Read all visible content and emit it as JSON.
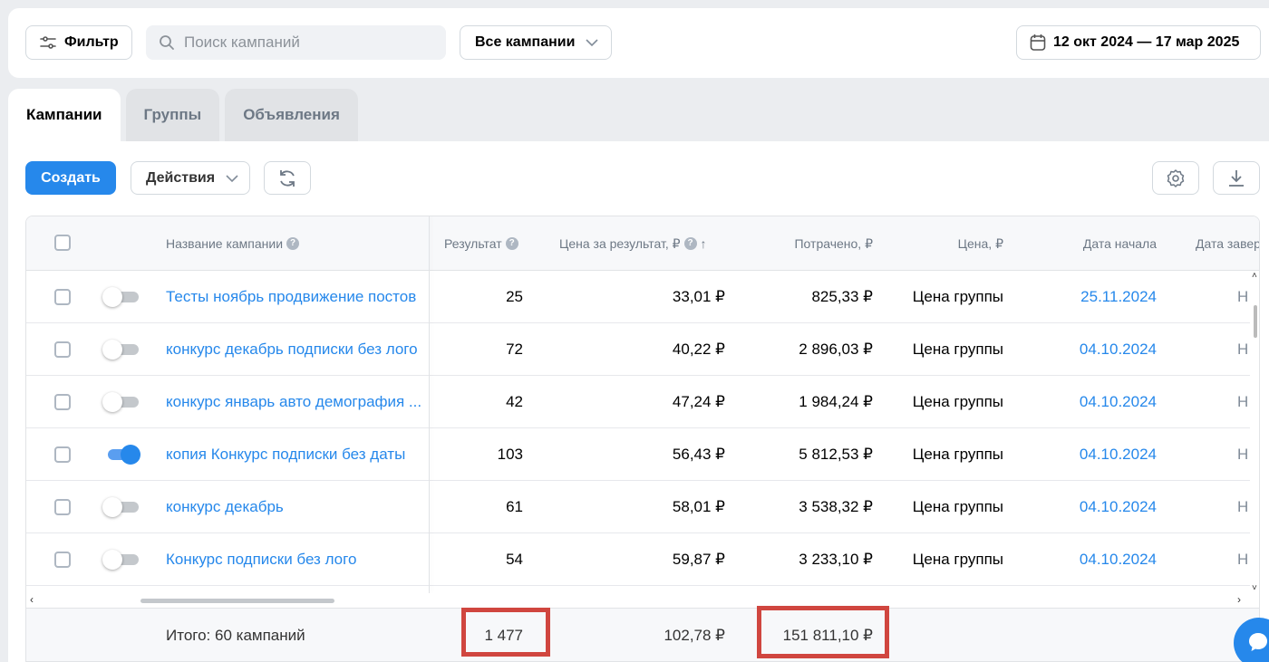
{
  "toolbar": {
    "filter_label": "Фильтр",
    "search_placeholder": "Поиск кампаний",
    "campaigns_select": "Все кампании",
    "date_range": "12 окт 2024 — 17 мар 2025"
  },
  "tabs": [
    {
      "label": "Кампании",
      "active": true
    },
    {
      "label": "Группы",
      "active": false
    },
    {
      "label": "Объявления",
      "active": false
    }
  ],
  "actions": {
    "create_label": "Создать",
    "actions_label": "Действия"
  },
  "table": {
    "columns": {
      "name": "Название кампании",
      "result": "Результат",
      "cost_per_result": "Цена за результат, ₽",
      "spent": "Потрачено, ₽",
      "price": "Цена, ₽",
      "start_date": "Дата начала",
      "end_date": "Дата завер"
    },
    "sort_indicator": "↑",
    "rows": [
      {
        "name": "Тесты ноябрь продвижение постов",
        "enabled": false,
        "result": "25",
        "cost_per_result": "33,01 ₽",
        "spent": "825,33 ₽",
        "price": "Цена группы",
        "start_date": "25.11.2024",
        "end_date": "Н"
      },
      {
        "name": "конкурс декабрь подписки без лого",
        "enabled": false,
        "result": "72",
        "cost_per_result": "40,22 ₽",
        "spent": "2 896,03 ₽",
        "price": "Цена группы",
        "start_date": "04.10.2024",
        "end_date": "Н"
      },
      {
        "name": "конкурс январь авто демография ...",
        "enabled": false,
        "result": "42",
        "cost_per_result": "47,24 ₽",
        "spent": "1 984,24 ₽",
        "price": "Цена группы",
        "start_date": "04.10.2024",
        "end_date": "Н"
      },
      {
        "name": "копия Конкурс подписки без даты",
        "enabled": true,
        "result": "103",
        "cost_per_result": "56,43 ₽",
        "spent": "5 812,53 ₽",
        "price": "Цена группы",
        "start_date": "04.10.2024",
        "end_date": "Н"
      },
      {
        "name": "конкурс декабрь",
        "enabled": false,
        "result": "61",
        "cost_per_result": "58,01 ₽",
        "spent": "3 538,32 ₽",
        "price": "Цена группы",
        "start_date": "04.10.2024",
        "end_date": "Н"
      },
      {
        "name": "Конкурс подписки без лого",
        "enabled": false,
        "result": "54",
        "cost_per_result": "59,87 ₽",
        "spent": "3 233,10 ₽",
        "price": "Цена группы",
        "start_date": "04.10.2024",
        "end_date": "Н"
      }
    ],
    "totals": {
      "label": "Итого: 60 кампаний",
      "result": "1 477",
      "cost_per_result": "102,78 ₽",
      "spent": "151 811,10 ₽"
    }
  },
  "colors": {
    "accent": "#2688eb",
    "highlight": "#d0463f",
    "background": "#ebedf0"
  },
  "icons": [
    "filter-icon",
    "search-icon",
    "chevron-down-icon",
    "calendar-icon",
    "refresh-icon",
    "gear-icon",
    "download-icon",
    "help-icon",
    "chat-icon"
  ]
}
